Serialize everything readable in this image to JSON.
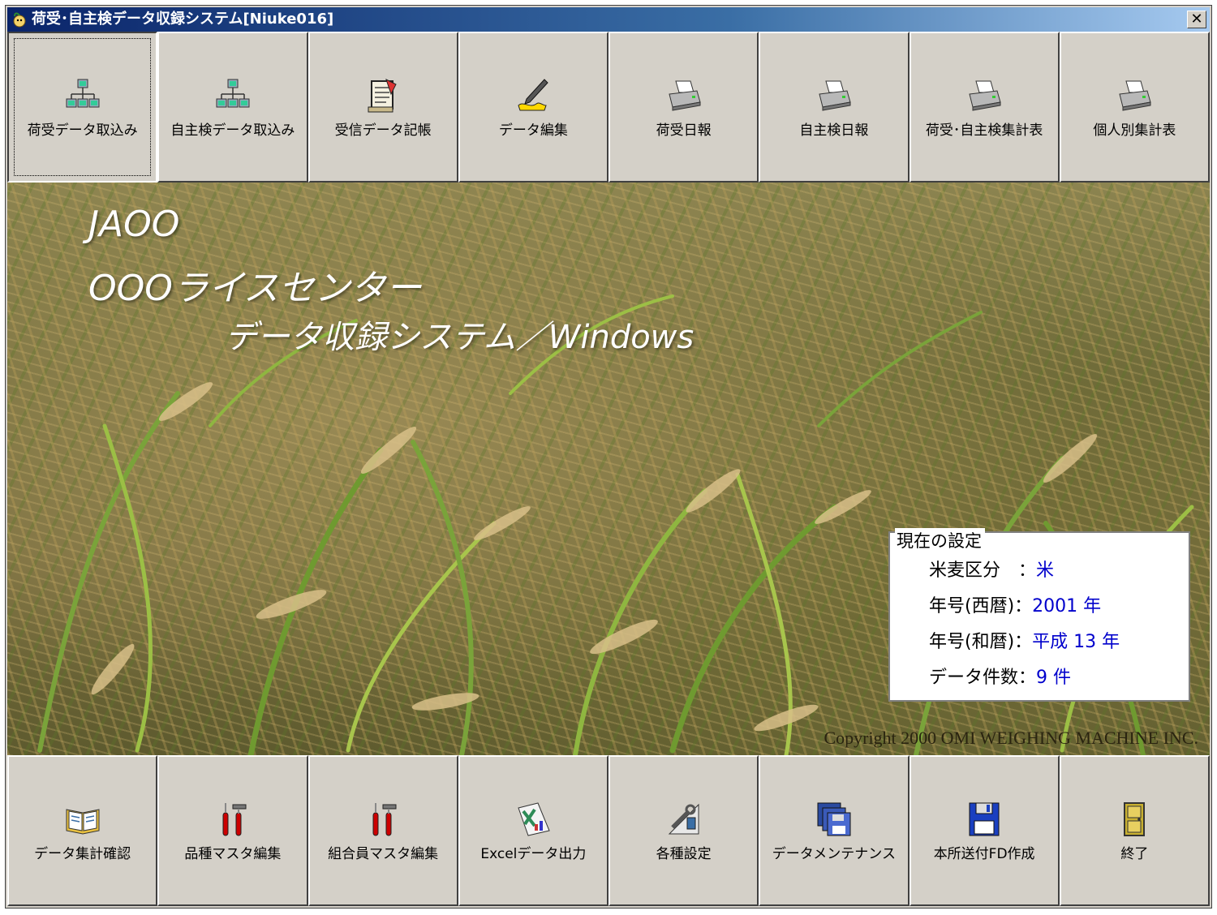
{
  "window": {
    "title": "荷受･自主検データ収録システム[Niuke016]",
    "close_label": "✕"
  },
  "top_toolbar": [
    {
      "label": "荷受データ取込み",
      "icon": "network-icon"
    },
    {
      "label": "自主検データ取込み",
      "icon": "network-icon"
    },
    {
      "label": "受信データ記帳",
      "icon": "ledger-icon"
    },
    {
      "label": "データ編集",
      "icon": "pen-icon"
    },
    {
      "label": "荷受日報",
      "icon": "printer-icon"
    },
    {
      "label": "自主検日報",
      "icon": "printer-icon"
    },
    {
      "label": "荷受･自主検集計表",
      "icon": "printer-icon"
    },
    {
      "label": "個人別集計表",
      "icon": "printer-icon"
    }
  ],
  "splash": {
    "line1": "JAOO",
    "line2": "OOOライスセンター",
    "line3": "データ収録システム／Windows"
  },
  "settings": {
    "title": "現在の設定",
    "rows": [
      {
        "label": "米麦区分　：",
        "value": "米"
      },
      {
        "label": "年号(西暦)：",
        "value": "2001 年"
      },
      {
        "label": "年号(和暦)：",
        "value": "平成 13 年"
      },
      {
        "label": "データ件数：",
        "value": "9 件"
      }
    ]
  },
  "copyright": "Copyright 2000 OMI WEIGHING MACHINE INC.",
  "bottom_toolbar": [
    {
      "label": "データ集計確認",
      "icon": "book-icon"
    },
    {
      "label": "品種マスタ編集",
      "icon": "tools-icon"
    },
    {
      "label": "組合員マスタ編集",
      "icon": "tools-icon"
    },
    {
      "label": "Excelデータ出力",
      "icon": "excel-icon"
    },
    {
      "label": "各種設定",
      "icon": "settings-tools-icon"
    },
    {
      "label": "データメンテナンス",
      "icon": "floppy-stack-icon"
    },
    {
      "label": "本所送付FD作成",
      "icon": "floppy-disk-icon"
    },
    {
      "label": "終了",
      "icon": "exit-door-icon"
    }
  ],
  "colors": {
    "title_gradient_start": "#0a246a",
    "button_face": "#d4d0c8",
    "settings_value": "#0000cc"
  }
}
